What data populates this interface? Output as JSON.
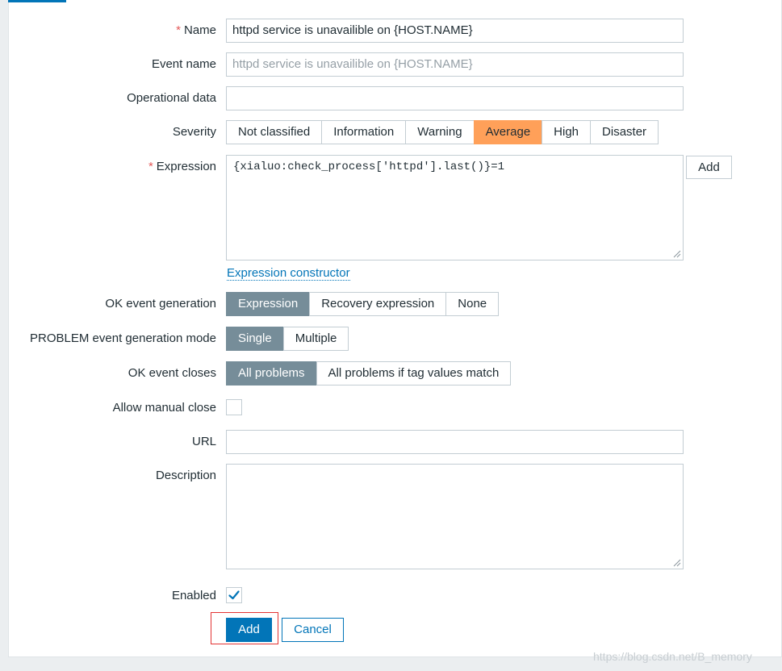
{
  "form": {
    "name": {
      "label": "Name",
      "required": "*",
      "value": "httpd service is  unavailible on {HOST.NAME}"
    },
    "event_name": {
      "label": "Event name",
      "placeholder": "httpd service is  unavailible on {HOST.NAME}"
    },
    "operational_data": {
      "label": "Operational data",
      "value": ""
    },
    "severity": {
      "label": "Severity",
      "options": [
        "Not classified",
        "Information",
        "Warning",
        "Average",
        "High",
        "Disaster"
      ],
      "selected": "Average"
    },
    "expression": {
      "label": "Expression",
      "required": "*",
      "value": "{xialuo:check_process['httpd'].last()}=1",
      "add_label": "Add",
      "constructor_link": "Expression constructor"
    },
    "ok_event_generation": {
      "label": "OK event generation",
      "options": [
        "Expression",
        "Recovery expression",
        "None"
      ],
      "selected": "Expression"
    },
    "problem_mode": {
      "label": "PROBLEM event generation mode",
      "options": [
        "Single",
        "Multiple"
      ],
      "selected": "Single"
    },
    "ok_event_closes": {
      "label": "OK event closes",
      "options": [
        "All problems",
        "All problems if tag values match"
      ],
      "selected": "All problems"
    },
    "allow_manual_close": {
      "label": "Allow manual close",
      "checked": false
    },
    "url": {
      "label": "URL",
      "value": ""
    },
    "description": {
      "label": "Description",
      "value": ""
    },
    "enabled": {
      "label": "Enabled",
      "checked": true
    }
  },
  "actions": {
    "add_label": "Add",
    "cancel_label": "Cancel"
  },
  "watermark": "https://blog.csdn.net/B_memory",
  "colors": {
    "accent": "#0275b8",
    "severity_average": "#ffa059",
    "segment_active": "#768d99",
    "required": "#e45959",
    "highlight_box": "#e33434"
  }
}
